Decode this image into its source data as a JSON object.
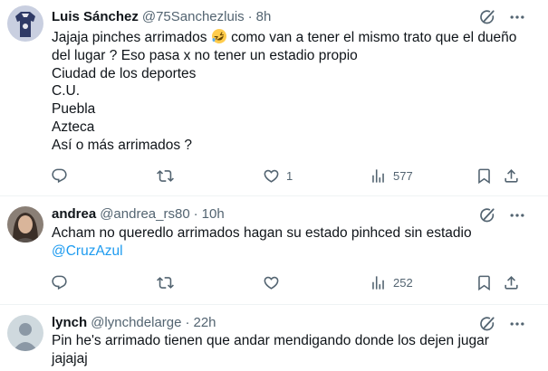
{
  "tweets": [
    {
      "name": "Luis Sánchez",
      "handle": "@75Sanchezluis",
      "dot": "·",
      "time": "8h",
      "text_before_emoji": "Jajaja pinches arrimados ",
      "emoji": "rolling-on-floor-laughing",
      "text_after_emoji": " como van a tener el mismo trato que el dueño",
      "lines": [
        "del lugar ? Eso pasa x no tener un estadio propio",
        "Ciudad de los deportes",
        "C.U.",
        "Puebla",
        "Azteca",
        "Así o más arrimados ?"
      ],
      "replies": "",
      "retweets": "",
      "likes": "1",
      "views": "577"
    },
    {
      "name": "andrea",
      "handle": "@andrea_rs80",
      "dot": "·",
      "time": "10h",
      "lines": [
        "Acham no queredlo arrimados hagan su estado pinhced sin estadio"
      ],
      "mention": "@CruzAzul",
      "replies": "",
      "retweets": "",
      "likes": "",
      "views": "252"
    },
    {
      "name": "lynch",
      "handle": "@lynchdelarge",
      "dot": "·",
      "time": "22h",
      "lines": [
        "Pin he's arrimado tienen que andar mendigando donde los dejen jugar",
        "jajajaj"
      ]
    }
  ],
  "icons": {
    "reply": "reply-icon",
    "retweet": "retweet-icon",
    "like": "heart-icon",
    "views": "views-icon",
    "bookmark": "bookmark-icon",
    "share": "share-icon",
    "grok": "grok-icon",
    "more": "more-icon"
  },
  "colors": {
    "text": "#0f1419",
    "secondary": "#536471",
    "link": "#1d9bf0",
    "divider": "#eff3f4"
  }
}
